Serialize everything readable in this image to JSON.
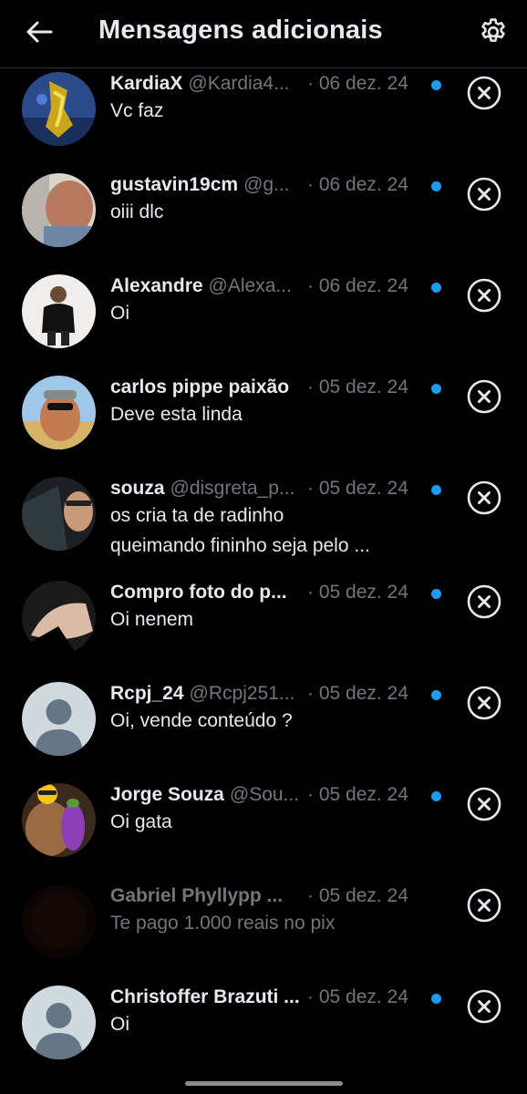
{
  "header": {
    "title": "Mensagens adicionais",
    "back_icon": "arrow-left-icon",
    "settings_icon": "gear-icon"
  },
  "colors": {
    "background": "#000000",
    "text_primary": "#e7e9ea",
    "text_secondary": "#71767b",
    "unread": "#1d9bf0"
  },
  "conversations": [
    {
      "name": "KardiaX",
      "handle": "@Kardia4...",
      "date": "· 06 dez. 24",
      "message": "Vc faz",
      "unread": true
    },
    {
      "name": "gustavin19cm",
      "handle": "@g...",
      "date": "· 06 dez. 24",
      "message": "oiii dlc",
      "unread": true
    },
    {
      "name": "Alexandre",
      "handle": "@Alexa...",
      "date": "· 06 dez. 24",
      "message": "Oi",
      "unread": true
    },
    {
      "name": "carlos pippe paixão",
      "handle": "",
      "date": "· 05 dez. 24",
      "message": "Deve esta linda",
      "unread": true
    },
    {
      "name": "souza",
      "handle": "@disgreta_p...",
      "date": "· 05 dez. 24",
      "message": "os cria ta de radinho",
      "message_line2": "queimando fininho seja pelo ...",
      "unread": true
    },
    {
      "name": "Compro foto do p...",
      "handle": "",
      "date": "· 05 dez. 24",
      "message": "Oi nenem",
      "unread": true
    },
    {
      "name": "Rcpj_24",
      "handle": "@Rcpj251...",
      "date": "· 05 dez. 24",
      "message": "Oi, vende conteúdo ?",
      "unread": true
    },
    {
      "name": "Jorge Souza",
      "handle": "@Sou...",
      "date": "· 05 dez. 24",
      "message": "Oi gata",
      "unread": true
    },
    {
      "name": "Gabriel Phyllypp ...",
      "handle": "",
      "date": "· 05 dez. 24",
      "message": "Te pago 1.000 reais no pix",
      "unread": false
    },
    {
      "name": "Christoffer Brazuti ...",
      "handle": "",
      "date": "· 05 dez. 24",
      "message": "Oi",
      "unread": true
    }
  ]
}
